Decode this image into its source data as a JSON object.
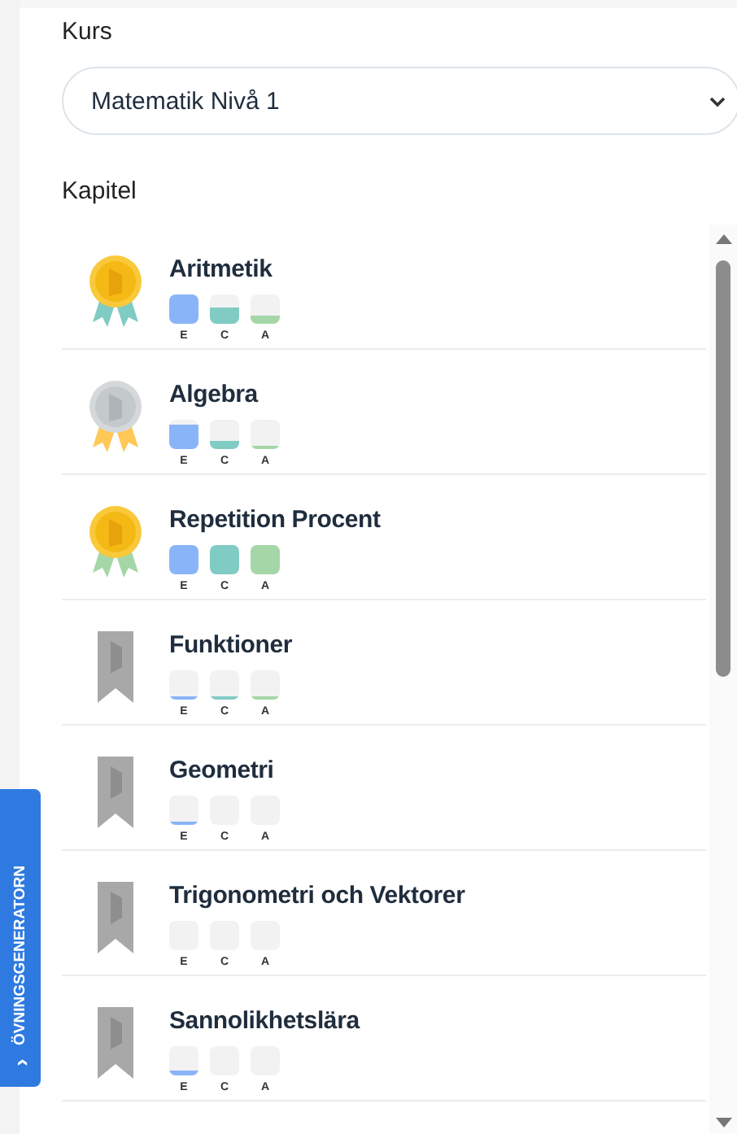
{
  "course": {
    "label": "Kurs",
    "value": "Matematik Nivå 1"
  },
  "chapters_label": "Kapitel",
  "chapters": [
    {
      "title": "Aritmetik",
      "badge": {
        "kind": "gold",
        "color": "#80cbc4"
      },
      "levels": [
        {
          "label": "E"
        },
        {
          "label": "C"
        },
        {
          "label": "A"
        }
      ]
    },
    {
      "title": "Algebra",
      "badge": {
        "kind": "silver",
        "color": "#ffc857"
      },
      "levels": [
        {
          "label": "E"
        },
        {
          "label": "C"
        },
        {
          "label": "A"
        }
      ]
    },
    {
      "title": "Repetition Procent",
      "badge": {
        "kind": "gold",
        "color": "#a5d6a7"
      },
      "levels": [
        {
          "label": "E"
        },
        {
          "label": "C"
        },
        {
          "label": "A"
        }
      ]
    },
    {
      "title": "Funktioner",
      "badge": {
        "kind": "none"
      },
      "levels": [
        {
          "label": "E"
        },
        {
          "label": "C"
        },
        {
          "label": "A"
        }
      ]
    },
    {
      "title": "Geometri",
      "badge": {
        "kind": "none"
      },
      "levels": [
        {
          "label": "E"
        },
        {
          "label": "C"
        },
        {
          "label": "A"
        }
      ]
    },
    {
      "title": "Trigonometri och Vektorer",
      "badge": {
        "kind": "none"
      },
      "levels": [
        {
          "label": "E"
        },
        {
          "label": "C"
        },
        {
          "label": "A"
        }
      ]
    },
    {
      "title": "Sannolikhetslära",
      "badge": {
        "kind": "none"
      },
      "levels": [
        {
          "label": "E"
        },
        {
          "label": "C"
        },
        {
          "label": "A"
        }
      ]
    }
  ],
  "side_tab": {
    "label": "ÖVNINGSGENERATORN",
    "icon": "›"
  }
}
